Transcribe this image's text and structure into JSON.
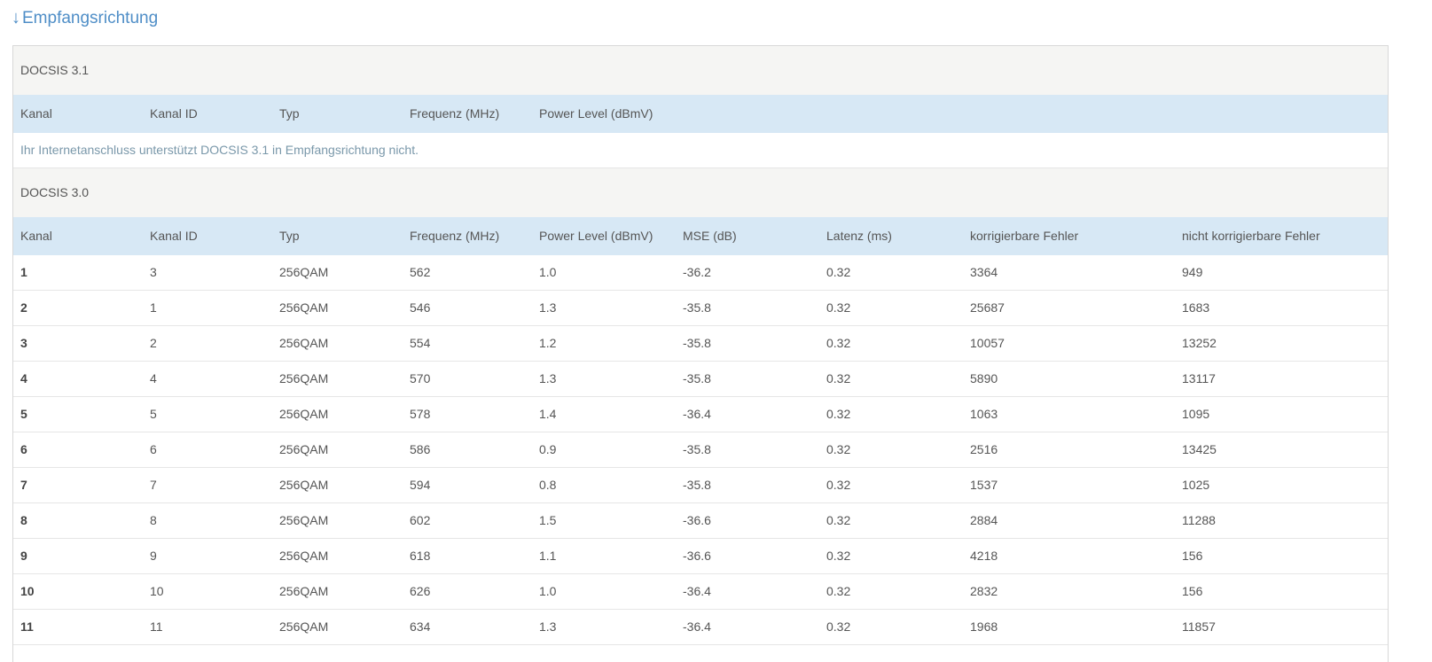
{
  "heading": {
    "arrow": "↓",
    "label": "Empfangsrichtung"
  },
  "docsis31": {
    "title": "DOCSIS 3.1",
    "columns": [
      "Kanal",
      "Kanal ID",
      "Typ",
      "Frequenz (MHz)",
      "Power Level (dBmV)"
    ],
    "note": "Ihr Internetanschluss unterstützt DOCSIS 3.1 in Empfangsrichtung nicht."
  },
  "docsis30": {
    "title": "DOCSIS 3.0",
    "columns": [
      "Kanal",
      "Kanal ID",
      "Typ",
      "Frequenz (MHz)",
      "Power Level (dBmV)",
      "MSE (dB)",
      "Latenz (ms)",
      "korrigierbare Fehler",
      "nicht korrigierbare Fehler"
    ],
    "rows": [
      [
        "1",
        "3",
        "256QAM",
        "562",
        "1.0",
        "-36.2",
        "0.32",
        "3364",
        "949"
      ],
      [
        "2",
        "1",
        "256QAM",
        "546",
        "1.3",
        "-35.8",
        "0.32",
        "25687",
        "1683"
      ],
      [
        "3",
        "2",
        "256QAM",
        "554",
        "1.2",
        "-35.8",
        "0.32",
        "10057",
        "13252"
      ],
      [
        "4",
        "4",
        "256QAM",
        "570",
        "1.3",
        "-35.8",
        "0.32",
        "5890",
        "13117"
      ],
      [
        "5",
        "5",
        "256QAM",
        "578",
        "1.4",
        "-36.4",
        "0.32",
        "1063",
        "1095"
      ],
      [
        "6",
        "6",
        "256QAM",
        "586",
        "0.9",
        "-35.8",
        "0.32",
        "2516",
        "13425"
      ],
      [
        "7",
        "7",
        "256QAM",
        "594",
        "0.8",
        "-35.8",
        "0.32",
        "1537",
        "1025"
      ],
      [
        "8",
        "8",
        "256QAM",
        "602",
        "1.5",
        "-36.6",
        "0.32",
        "2884",
        "11288"
      ],
      [
        "9",
        "9",
        "256QAM",
        "618",
        "1.1",
        "-36.6",
        "0.32",
        "4218",
        "156"
      ],
      [
        "10",
        "10",
        "256QAM",
        "626",
        "1.0",
        "-36.4",
        "0.32",
        "2832",
        "156"
      ],
      [
        "11",
        "11",
        "256QAM",
        "634",
        "1.3",
        "-36.4",
        "0.32",
        "1968",
        "11857"
      ]
    ]
  }
}
